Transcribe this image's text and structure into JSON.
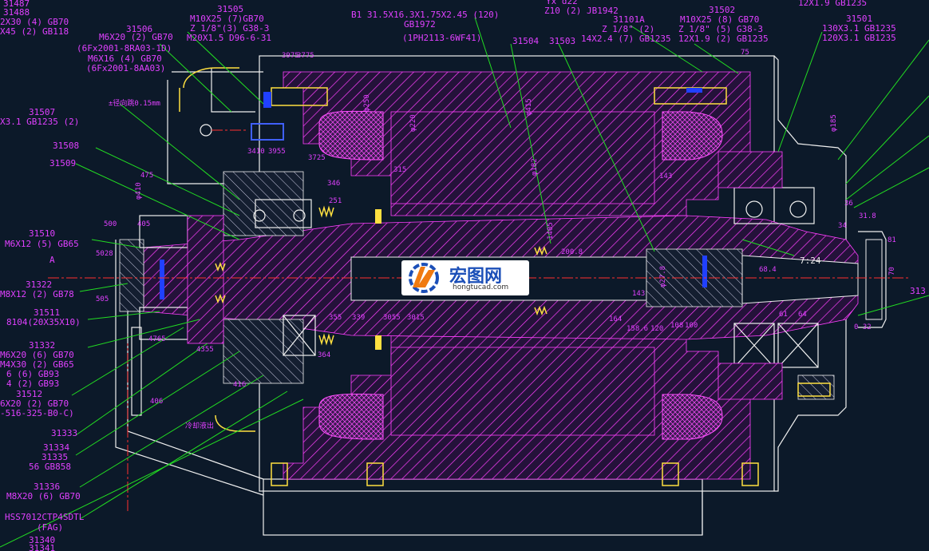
{
  "colors": {
    "background": "#0c1929",
    "label": "#e040ff",
    "leader": "#22dd22",
    "outline": "#f0f0f0",
    "centerline": "#ff3030"
  },
  "labels": [
    {
      "id": "l1",
      "text": "31487"
    },
    {
      "id": "l2",
      "text": "31488"
    },
    {
      "id": "l3",
      "text": "2X30 (4) GB70"
    },
    {
      "id": "l4",
      "text": "X45 (2) GB118"
    },
    {
      "id": "l5",
      "text": "31505"
    },
    {
      "id": "l6",
      "text": "M10X25 (7)GB70"
    },
    {
      "id": "l7",
      "text": "Z 1/8\"(3) G38-3"
    },
    {
      "id": "l8",
      "text": "M20X1.5 D96-6-31"
    },
    {
      "id": "l9",
      "text": "31506"
    },
    {
      "id": "l10",
      "text": "M6X20 (2) GB70"
    },
    {
      "id": "l11",
      "text": "(6Fx2001-8RA03-1D)"
    },
    {
      "id": "l12",
      "text": "M6X16 (4) GB70"
    },
    {
      "id": "l13",
      "text": "(6Fx2001-8AA03)"
    },
    {
      "id": "l14",
      "text": "B1 31.5X16.3X1.75X2.45 (120)"
    },
    {
      "id": "l15",
      "text": "GB1972"
    },
    {
      "id": "l16",
      "text": "(1PH2113-6WF41)"
    },
    {
      "id": "l17",
      "text": "Yx d22"
    },
    {
      "id": "l18",
      "text": "Z10 (2) JB1942"
    },
    {
      "id": "l19",
      "text": "31101A"
    },
    {
      "id": "l20",
      "text": "Z 1/8\" (2)"
    },
    {
      "id": "l21",
      "text": "14X2.4 (7) GB1235"
    },
    {
      "id": "l22",
      "text": "31502"
    },
    {
      "id": "l23",
      "text": "M10X25 (8) GB70"
    },
    {
      "id": "l24",
      "text": "Z 1/8\" (5) G38-3"
    },
    {
      "id": "l25",
      "text": "12X1.9 (2) GB1235"
    },
    {
      "id": "l26",
      "text": "12X1.9 GB1235"
    },
    {
      "id": "l27",
      "text": "31501"
    },
    {
      "id": "l28",
      "text": "130X3.1 GB1235"
    },
    {
      "id": "l29",
      "text": "120X3.1 GB1235"
    },
    {
      "id": "l30",
      "text": "31504"
    },
    {
      "id": "l31",
      "text": "31503"
    },
    {
      "id": "l32",
      "text": "31507"
    },
    {
      "id": "l33",
      "text": "X3.1 GB1235 (2)"
    },
    {
      "id": "l34",
      "text": "31508"
    },
    {
      "id": "l35",
      "text": "31509"
    },
    {
      "id": "l36",
      "text": "31510"
    },
    {
      "id": "l37",
      "text": "M6X12 (5) GB65"
    },
    {
      "id": "l38",
      "text": "A"
    },
    {
      "id": "l39",
      "text": "31322"
    },
    {
      "id": "l40",
      "text": "M8X12 (2) GB78"
    },
    {
      "id": "l41",
      "text": "31511"
    },
    {
      "id": "l42",
      "text": "8104(20X35X10)"
    },
    {
      "id": "l43",
      "text": "31332"
    },
    {
      "id": "l44",
      "text": "M6X20 (6) GB70"
    },
    {
      "id": "l45",
      "text": "M4X30 (2) GB65"
    },
    {
      "id": "l46",
      "text": "6 (6) GB93"
    },
    {
      "id": "l47",
      "text": "4 (2) GB93"
    },
    {
      "id": "l48",
      "text": "31512"
    },
    {
      "id": "l49",
      "text": "6X20 (2) GB70"
    },
    {
      "id": "l50",
      "text": "-516-325-B0-C)"
    },
    {
      "id": "l51",
      "text": "31333"
    },
    {
      "id": "l52",
      "text": "31334"
    },
    {
      "id": "l53",
      "text": "31335"
    },
    {
      "id": "l54",
      "text": "56 GB858"
    },
    {
      "id": "l55",
      "text": "31336"
    },
    {
      "id": "l56",
      "text": "M8X20 (6) GB70"
    },
    {
      "id": "l57",
      "text": "HSS7012CTP4SDTL"
    },
    {
      "id": "l58",
      "text": "(FAG)"
    },
    {
      "id": "l59",
      "text": "31340"
    },
    {
      "id": "l60",
      "text": "31341"
    },
    {
      "id": "l61",
      "text": "313"
    },
    {
      "id": "l62",
      "text": "7:24"
    },
    {
      "id": "l63",
      "text": "±径向跳0.15mm"
    },
    {
      "id": "l64",
      "text": "冷却液出"
    }
  ],
  "dims": [
    {
      "id": "d1",
      "text": "3975"
    },
    {
      "id": "d2",
      "text": "3775"
    },
    {
      "id": "d3",
      "text": "φ250"
    },
    {
      "id": "d4",
      "text": "φ220"
    },
    {
      "id": "d5",
      "text": "φ415"
    },
    {
      "id": "d6",
      "text": "315"
    },
    {
      "id": "d7",
      "text": "φ182"
    },
    {
      "id": "d8",
      "text": "143"
    },
    {
      "id": "d9",
      "text": "75"
    },
    {
      "id": "d10",
      "text": "φ185"
    },
    {
      "id": "d11",
      "text": "3725"
    },
    {
      "id": "d12",
      "text": "3410"
    },
    {
      "id": "d13",
      "text": "3955"
    },
    {
      "id": "d14",
      "text": "475"
    },
    {
      "id": "d15",
      "text": "φ410"
    },
    {
      "id": "d16",
      "text": "500"
    },
    {
      "id": "d17",
      "text": "405"
    },
    {
      "id": "d18",
      "text": "5028"
    },
    {
      "id": "d19",
      "text": "505"
    },
    {
      "id": "d20",
      "text": "346"
    },
    {
      "id": "d21",
      "text": "251"
    },
    {
      "id": "d22",
      "text": "1405"
    },
    {
      "id": "d23",
      "text": "200.8"
    },
    {
      "id": "d24",
      "text": "61"
    },
    {
      "id": "d25",
      "text": "64"
    },
    {
      "id": "d26",
      "text": "36"
    },
    {
      "id": "d27",
      "text": "34"
    },
    {
      "id": "d28",
      "text": "31.8"
    },
    {
      "id": "d29",
      "text": "81"
    },
    {
      "id": "d30",
      "text": "70"
    },
    {
      "id": "d31",
      "text": "0 32"
    },
    {
      "id": "d32",
      "text": "3055"
    },
    {
      "id": "d33",
      "text": "3015"
    },
    {
      "id": "d34",
      "text": "158.6"
    },
    {
      "id": "d35",
      "text": "120"
    },
    {
      "id": "d36",
      "text": "108"
    },
    {
      "id": "d37",
      "text": "100"
    },
    {
      "id": "d38",
      "text": "416"
    },
    {
      "id": "d39",
      "text": "406"
    },
    {
      "id": "d40",
      "text": "4765"
    },
    {
      "id": "d41",
      "text": "4355"
    },
    {
      "id": "d42",
      "text": "364"
    },
    {
      "id": "d43",
      "text": "355"
    },
    {
      "id": "d44",
      "text": "339"
    },
    {
      "id": "d45",
      "text": "68.4"
    },
    {
      "id": "d46",
      "text": "φ27.8"
    },
    {
      "id": "d47",
      "text": "143"
    },
    {
      "id": "d48",
      "text": "164"
    }
  ],
  "logo": {
    "name": "宏图网",
    "url": "hongtucad.com",
    "icon": "hongtu-logo-icon"
  }
}
